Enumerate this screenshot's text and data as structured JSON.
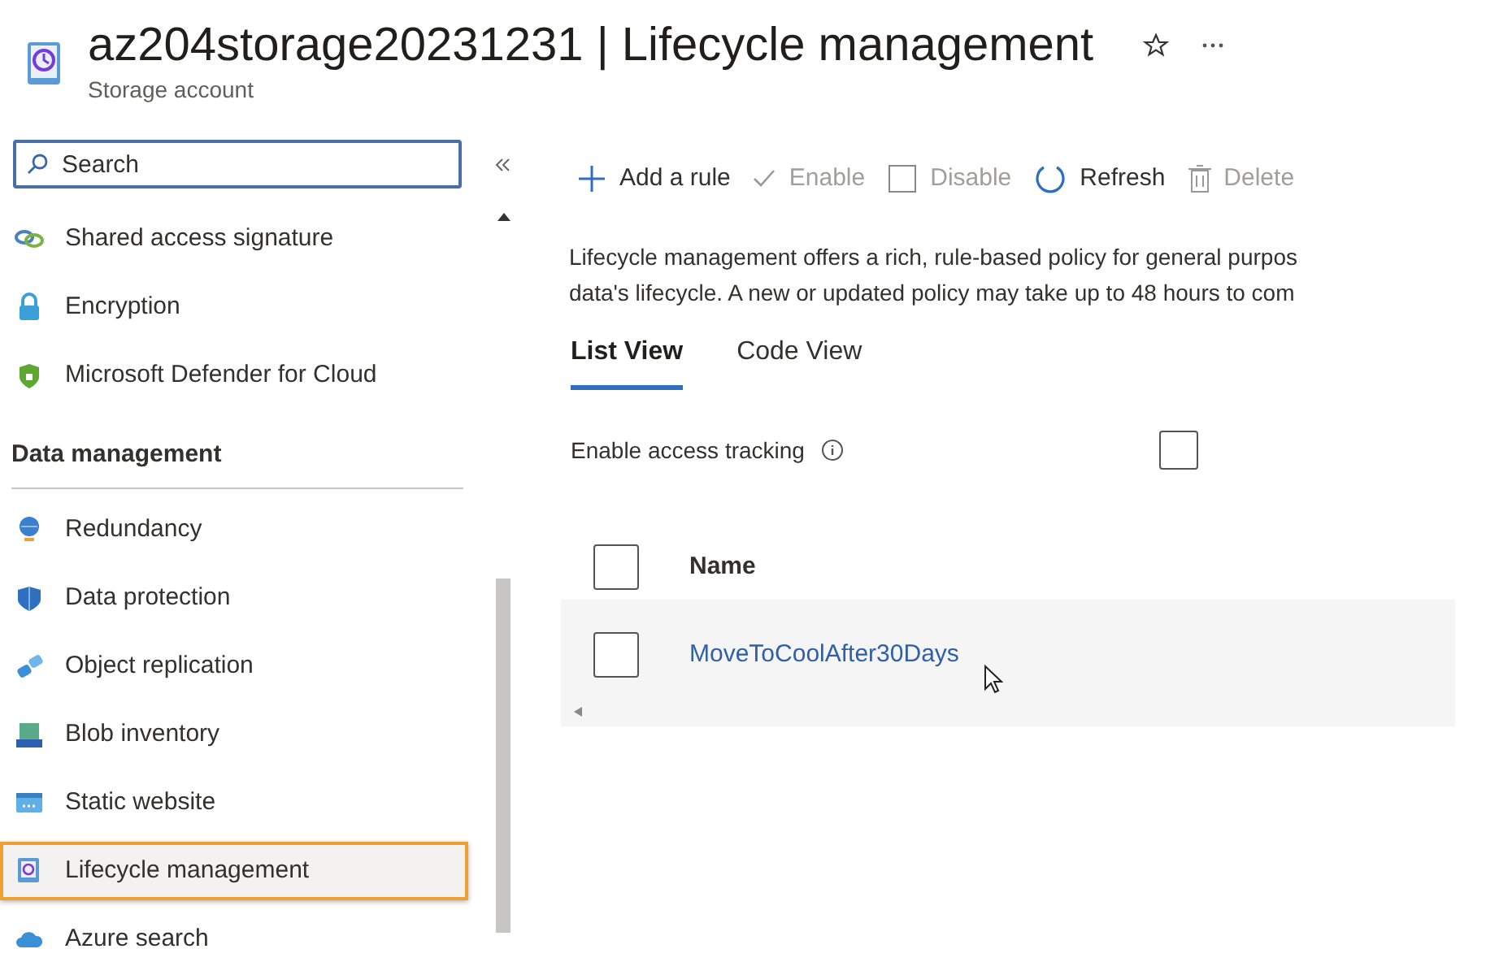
{
  "header": {
    "title": "az204storage20231231 | Lifecycle management",
    "subtitle": "Storage account"
  },
  "sidebar": {
    "search": {
      "placeholder": "Search"
    },
    "items": [
      {
        "label": "Shared access signature",
        "selected": false
      },
      {
        "label": "Encryption",
        "selected": false
      },
      {
        "label": "Microsoft Defender for Cloud",
        "selected": false
      }
    ],
    "section": {
      "title": "Data management",
      "items": [
        {
          "label": "Redundancy",
          "selected": false
        },
        {
          "label": "Data protection",
          "selected": false
        },
        {
          "label": "Object replication",
          "selected": false
        },
        {
          "label": "Blob inventory",
          "selected": false
        },
        {
          "label": "Static website",
          "selected": false
        },
        {
          "label": "Lifecycle management",
          "selected": true
        },
        {
          "label": "Azure search",
          "selected": false
        }
      ]
    }
  },
  "toolbar": [
    {
      "label": "Add a rule",
      "disabled": false
    },
    {
      "label": "Enable",
      "disabled": true
    },
    {
      "label": "Disable",
      "disabled": true
    },
    {
      "label": "Refresh",
      "disabled": false
    },
    {
      "label": "Delete",
      "disabled": true
    }
  ],
  "description": [
    "Lifecycle management offers a rich, rule-based policy for general purpos",
    "data's lifecycle. A new or updated policy may take up to 48 hours to com"
  ],
  "tabs": [
    {
      "label": "List View",
      "selected": true
    },
    {
      "label": "Code View",
      "selected": false
    }
  ],
  "access_tracking": {
    "label": "Enable access tracking",
    "checked": false
  },
  "table": {
    "columns": [
      "Name"
    ],
    "select_all": {
      "checked": false
    },
    "rows": [
      {
        "name": "MoveToCoolAfter30Days",
        "checked": false
      }
    ]
  }
}
